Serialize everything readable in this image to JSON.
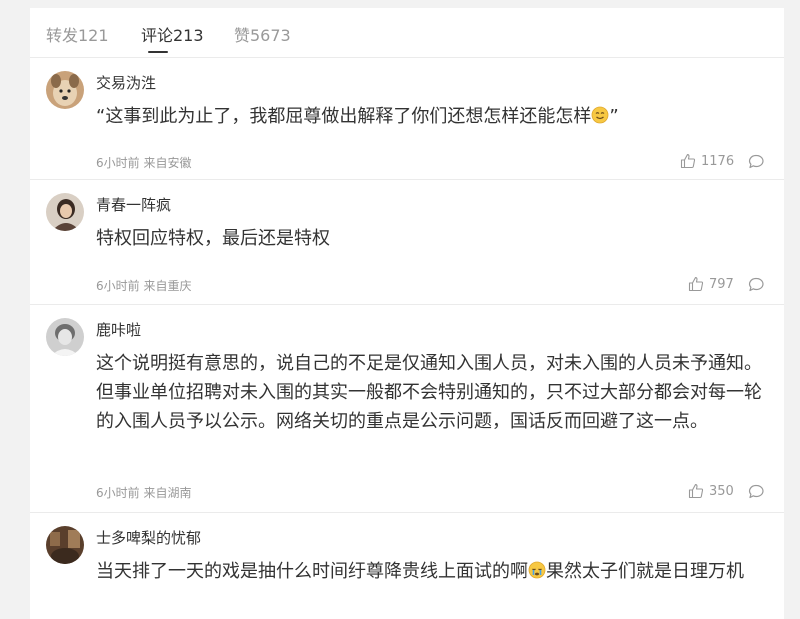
{
  "tabs": [
    {
      "label": "转发121"
    },
    {
      "label": "评论213"
    },
    {
      "label": "赞5673"
    }
  ],
  "comments": [
    {
      "username": "交易沩泩",
      "text": "“这事到此为止了，我都屈尊做出解释了你们还想怎样还能怎样",
      "text_end": "”",
      "emoji": "smile-emoji",
      "meta": "6小时前 来自安徽",
      "likes": "1176"
    },
    {
      "username": "青春一阵疯",
      "text": "特权回应特权，最后还是特权",
      "meta": "6小时前 来自重庆",
      "likes": "797"
    },
    {
      "username": "鹿咔啦",
      "text": "这个说明挺有意思的，说自己的不足是仅通知入围人员，对未入围的人员未予通知。但事业单位招聘对未入围的其实一般都不会特别通知的，只不过大部分都会对每一轮的入围人员予以公示。网络关切的重点是公示问题，国话反而回避了这一点。",
      "meta": "6小时前 来自湖南",
      "likes": "350"
    },
    {
      "username": "士多啤梨的忧郁",
      "text": "当天排了一天的戏是抽什么时间纡尊降贵线上面试的啊",
      "text_end": "果然太子们就是日理万机",
      "emoji": "crying-emoji"
    }
  ]
}
